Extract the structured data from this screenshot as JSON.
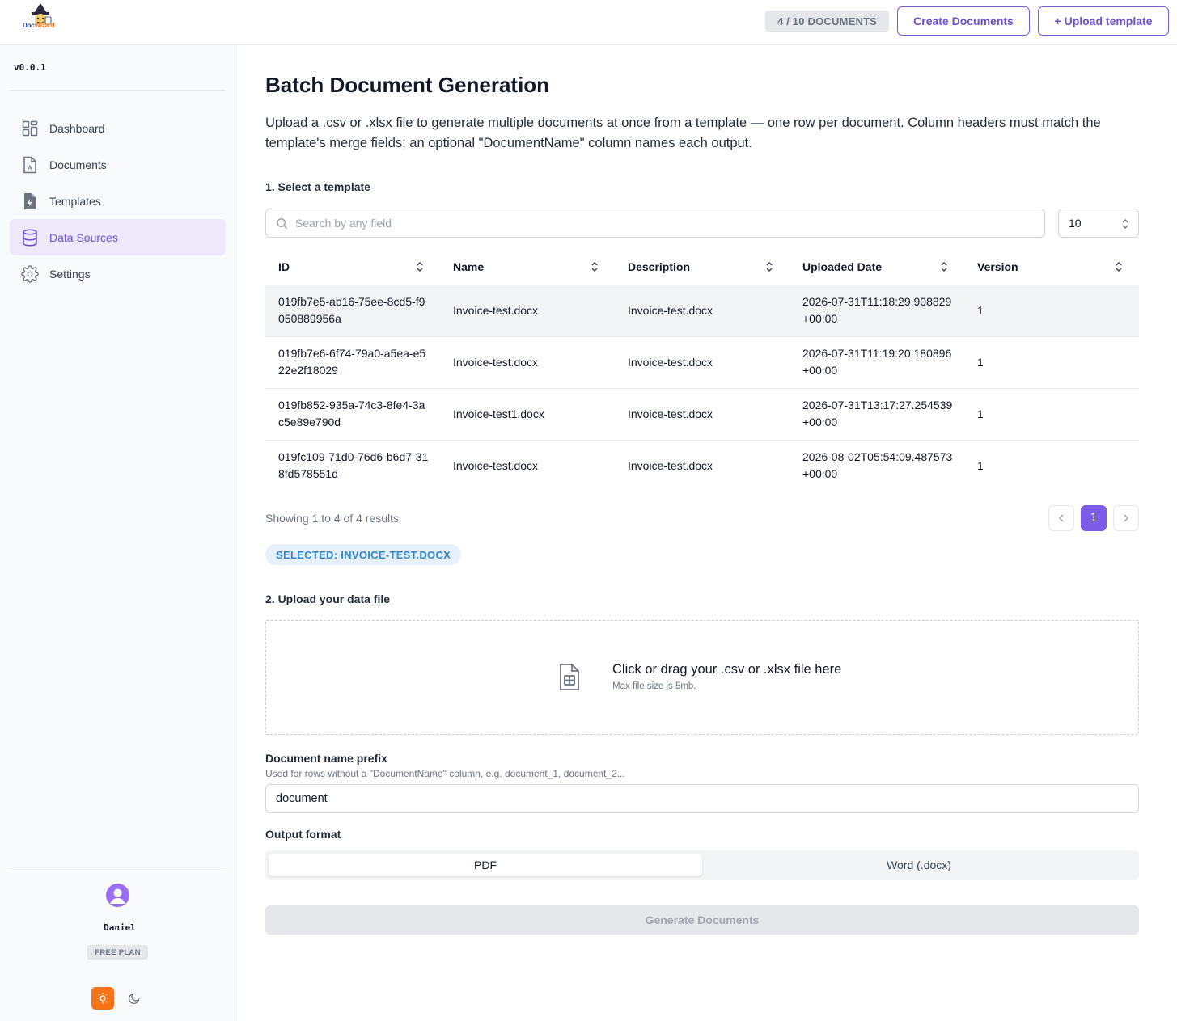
{
  "app": {
    "logo_text_main": "Doc",
    "logo_text_accent": "Wizard",
    "version": "v0.0.1"
  },
  "header": {
    "doc_count": "4 / 10 DOCUMENTS",
    "create_label": "Create Documents",
    "upload_label": "+ Upload template"
  },
  "sidebar": {
    "items": [
      {
        "label": "Dashboard",
        "icon": "dashboard-icon",
        "active": false
      },
      {
        "label": "Documents",
        "icon": "document-icon",
        "active": false
      },
      {
        "label": "Templates",
        "icon": "template-icon",
        "active": false
      },
      {
        "label": "Data Sources",
        "icon": "database-icon",
        "active": true
      },
      {
        "label": "Settings",
        "icon": "gear-icon",
        "active": false
      }
    ],
    "user": {
      "name": "Daniel",
      "plan": "FREE PLAN"
    }
  },
  "main": {
    "title": "Batch Document Generation",
    "description": "Upload a .csv or .xlsx file to generate multiple documents at once from a template — one row per document. Column headers must match the template's merge fields; an optional \"DocumentName\" column names each output.",
    "step1_label": "1. Select a template",
    "search_placeholder": "Search by any field",
    "page_size": "10",
    "table": {
      "columns": [
        "ID",
        "Name",
        "Description",
        "Uploaded Date",
        "Version"
      ],
      "rows": [
        {
          "id": "019fb7e5-ab16-75ee-8cd5-f9050889956a",
          "name": "Invoice-test.docx",
          "description": "Invoice-test.docx",
          "uploaded": "2026-07-31T11:18:29.908829+00:00",
          "version": "1",
          "selected": true
        },
        {
          "id": "019fb7e6-6f74-79a0-a5ea-e522e2f18029",
          "name": "Invoice-test.docx",
          "description": "Invoice-test.docx",
          "uploaded": "2026-07-31T11:19:20.180896+00:00",
          "version": "1",
          "selected": false
        },
        {
          "id": "019fb852-935a-74c3-8fe4-3ac5e89e790d",
          "name": "Invoice-test1.docx",
          "description": "Invoice-test.docx",
          "uploaded": "2026-07-31T13:17:27.254539+00:00",
          "version": "1",
          "selected": false
        },
        {
          "id": "019fc109-71d0-76d6-b6d7-318fd578551d",
          "name": "Invoice-test.docx",
          "description": "Invoice-test.docx",
          "uploaded": "2026-08-02T05:54:09.487573+00:00",
          "version": "1",
          "selected": false
        }
      ]
    },
    "showing": "Showing 1 to 4 of 4 results",
    "current_page": "1",
    "selected_pill": "SELECTED: INVOICE-TEST.DOCX",
    "step2_label": "2. Upload your data file",
    "dropzone_title": "Click or drag your .csv or .xlsx file here",
    "dropzone_sub": "Max file size is 5mb.",
    "prefix_label": "Document name prefix",
    "prefix_hint": "Used for rows without a \"DocumentName\" column, e.g. document_1, document_2...",
    "prefix_value": "document",
    "output_label": "Output format",
    "output_options": [
      "PDF",
      "Word (.docx)"
    ],
    "output_selected": "PDF",
    "generate_label": "Generate Documents"
  },
  "colors": {
    "accent": "#7c5ce6",
    "active_nav_bg": "#ede9fb",
    "selected_pill_text": "#2f86d0",
    "theme_sun_bg": "#f97316"
  }
}
